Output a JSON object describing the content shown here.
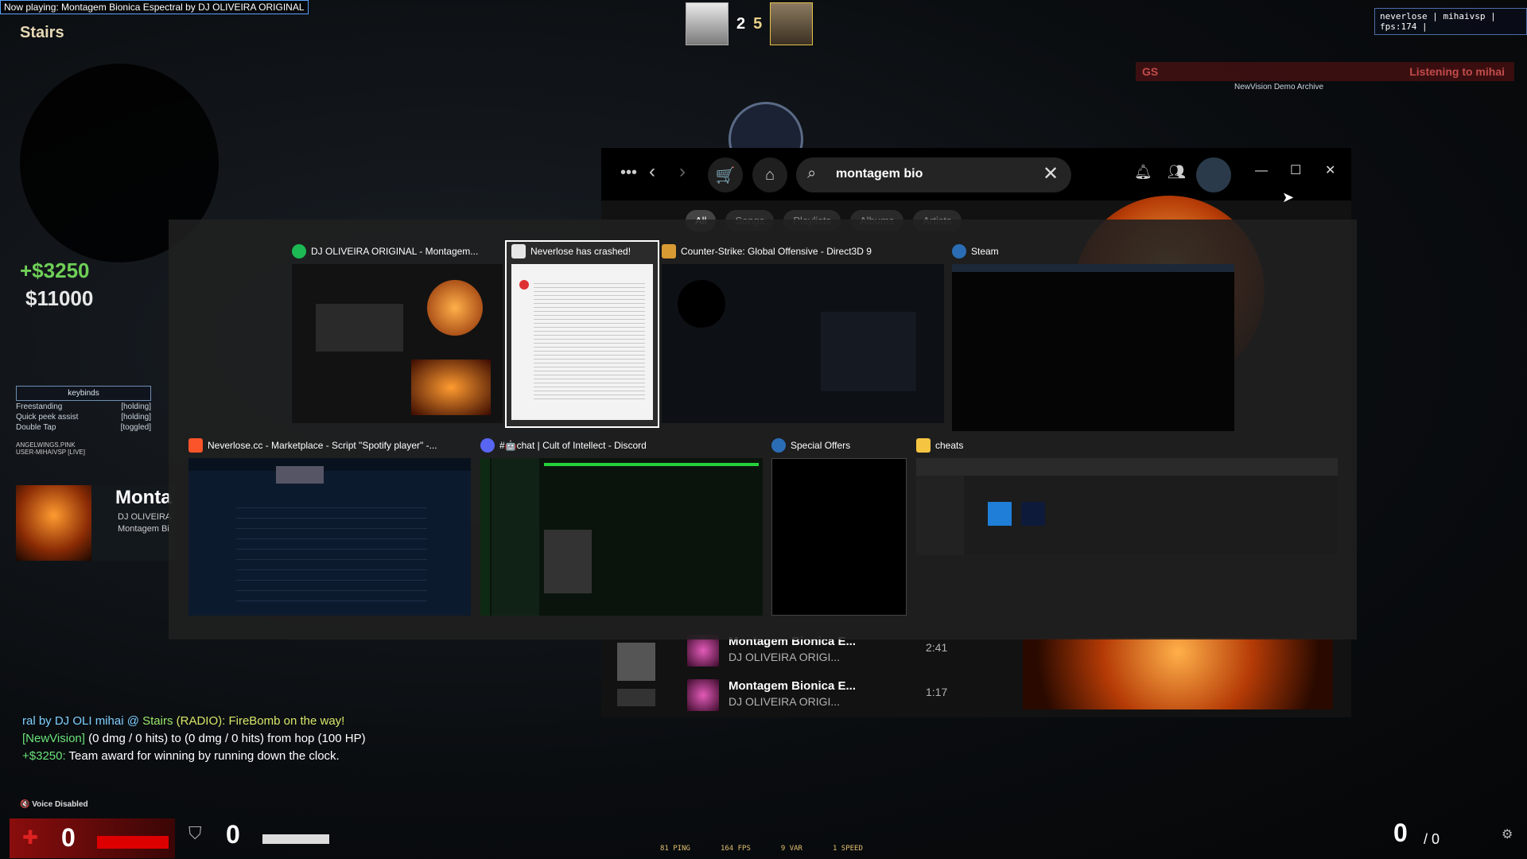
{
  "game": {
    "now_playing": "Now playing: Montagem Bionica Espectral by DJ OLIVEIRA ORIGINAL",
    "map": "Stairs",
    "score_ct": "2",
    "score_t": "5",
    "watermark": "neverlose | mihaivsp | fps:174 |",
    "spectator_bar": "Listening to mihai",
    "demo_archive": "NewVision Demo Archive",
    "money_delta": "+$3250",
    "money_total": "$11000",
    "keybinds": {
      "title": "keybinds",
      "rows": [
        {
          "name": "Freestanding",
          "state": "[holding]"
        },
        {
          "name": "Quick peek assist",
          "state": "[holding]"
        },
        {
          "name": "Double Tap",
          "state": "[toggled]"
        }
      ]
    },
    "spectators": [
      "ANGELWINGS.PINK",
      "USER-MIHAIVSP [LIVE]"
    ],
    "np_card": {
      "title": "Monta",
      "artist": "DJ OLIVEIRA",
      "album": "Montagem Bi"
    },
    "chat": [
      {
        "a": "ral by DJ OLI mihai @ ",
        "b": "Stairs",
        "c": " (RADIO): FireBomb on the way!"
      },
      {
        "a": "[NewVision]",
        "b": "",
        "c": " (0 dmg / 0 hits) to (0 dmg / 0 hits) from hop (100 HP)"
      },
      {
        "a": "+$3250:",
        "b": "",
        "c": " Team award for winning by running down the clock."
      }
    ],
    "voice": "Voice Disabled",
    "hp": "0",
    "armor": "0",
    "ammo": "0",
    "ammo_reserve": "/ 0",
    "net": [
      "81 PING",
      "164 FPS",
      "9 VAR",
      "1 SPEED"
    ]
  },
  "spotify": {
    "search_value": "montagem bio",
    "filters": [
      "All",
      "Songs",
      "Playlists",
      "Albums",
      "Artists"
    ],
    "songs": [
      {
        "title": "Montagem Bionica E...",
        "artist": "DJ OLIVEIRA ORIGI...",
        "duration": "2:41"
      },
      {
        "title": "Montagem Bionica E...",
        "artist": "DJ OLIVEIRA ORIGI...",
        "duration": "1:17"
      }
    ]
  },
  "alt_tab": {
    "windows": [
      {
        "title": "DJ OLIVEIRA ORIGINAL - Montagem...",
        "icon": "spotify-icon",
        "color": "#1db954"
      },
      {
        "title": "Neverlose has crashed!",
        "icon": "app-icon",
        "color": "#e6e6e6"
      },
      {
        "title": "Counter-Strike: Global Offensive - Direct3D 9",
        "icon": "csgo-icon",
        "color": "#d89a33"
      },
      {
        "title": "Steam",
        "icon": "steam-icon",
        "color": "#2a6db5"
      },
      {
        "title": "Neverlose.cc - Marketplace - Script \"Spotify player\" -...",
        "icon": "brave-icon",
        "color": "#fb542b"
      },
      {
        "title": "#🤖chat | Cult of Intellect - Discord",
        "icon": "discord-icon",
        "color": "#5865f2"
      },
      {
        "title": "Special Offers",
        "icon": "steam-icon",
        "color": "#2a6db5"
      },
      {
        "title": "cheats",
        "icon": "folder-icon",
        "color": "#f5c542"
      }
    ]
  }
}
